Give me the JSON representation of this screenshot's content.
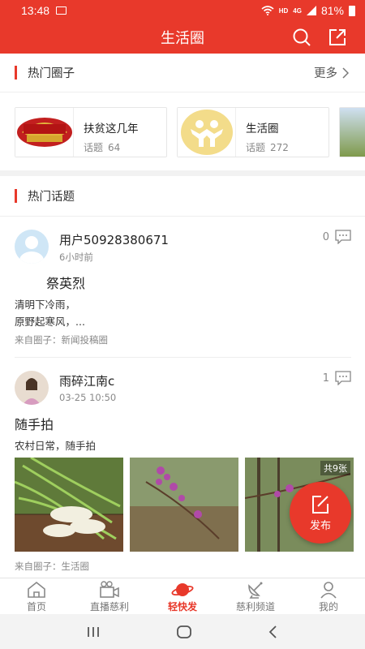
{
  "status": {
    "time": "13:48",
    "network": "HD",
    "signal": "4G",
    "battery": "81%"
  },
  "header": {
    "title": "生活圈"
  },
  "hot_circles": {
    "title": "热门圈子",
    "more": "更多",
    "items": [
      {
        "name": "扶贫这几年",
        "count_label": "话题",
        "count": "64"
      },
      {
        "name": "生活圈",
        "count_label": "话题",
        "count": "272"
      }
    ]
  },
  "hot_topics": {
    "title": "热门话题"
  },
  "posts": [
    {
      "user": "用户50928380671",
      "time": "6小时前",
      "comments": "0",
      "title": "祭英烈",
      "body_line1": "清明下冷雨，",
      "body_line2": "原野起寒风，...",
      "from": "来自圈子：新闻投稿圈"
    },
    {
      "user": "雨碎江南c",
      "time": "03-25 10:50",
      "comments": "1",
      "title": "随手拍",
      "body": "农村日常，随手拍",
      "image_count": "共9张",
      "from": "来自圈子：生活圈"
    }
  ],
  "fab": {
    "label": "发布"
  },
  "nav": [
    {
      "label": "首页",
      "icon": "home-icon"
    },
    {
      "label": "直播慈利",
      "icon": "live-camera-icon"
    },
    {
      "label": "轻快发",
      "icon": "planet-icon"
    },
    {
      "label": "慈利频道",
      "icon": "satellite-dish-icon"
    },
    {
      "label": "我的",
      "icon": "user-icon"
    }
  ]
}
